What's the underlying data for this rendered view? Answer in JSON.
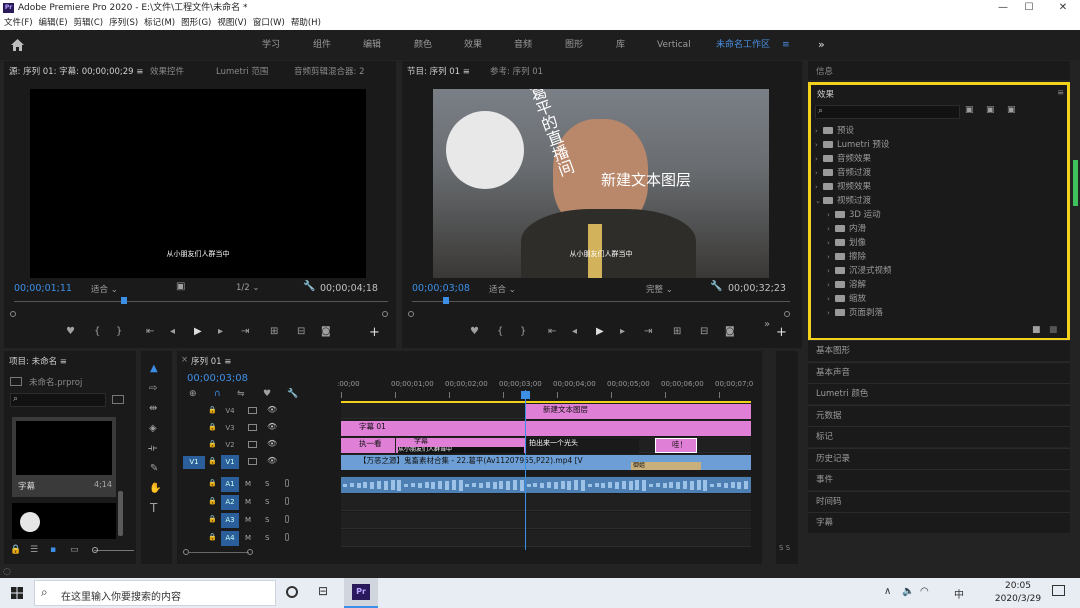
{
  "app": {
    "title": "Adobe Premiere Pro 2020 - E:\\文件\\工程文件\\未命名 *",
    "logo": "Pr"
  },
  "window_controls": {
    "minimize": "—",
    "maximize": "☐",
    "close": "✕"
  },
  "menu": [
    "文件(F)",
    "编辑(E)",
    "剪辑(C)",
    "序列(S)",
    "标记(M)",
    "图形(G)",
    "视图(V)",
    "窗口(W)",
    "帮助(H)"
  ],
  "workspaces": {
    "home_icon": "home-icon",
    "tabs": [
      "学习",
      "组件",
      "编辑",
      "颜色",
      "效果",
      "音频",
      "图形",
      "库",
      "Vertical",
      "未命名工作区"
    ],
    "active": "未命名工作区",
    "menu_glyph": "≡",
    "more": "»"
  },
  "source_monitor": {
    "tabs": [
      "源: 序列 01: 字幕: 00;00;00;29 ≡",
      "效果控件",
      "Lumetri 范围",
      "音频剪辑混合器: 2"
    ],
    "subtitle": "从小朋友们人群当中",
    "timecode": "00;00;01;11",
    "fit": "适合",
    "resolution": "1/2",
    "duration": "00;00;04;18"
  },
  "program_monitor": {
    "tabs": [
      "节目: 序列 01 ≡",
      "参考: 序列 01"
    ],
    "curved_text": "葛平的直播间",
    "text_layer": "新建文本图层",
    "subtitle": "从小朋友们人群当中",
    "timecode": "00;00;03;08",
    "fit": "适合",
    "quality": "完整",
    "duration": "00;00;32;23"
  },
  "info_panel": {
    "title": "信息"
  },
  "effects": {
    "title": "效果",
    "menu_glyph": "≡",
    "search_placeholder": "",
    "items": [
      {
        "label": "预设",
        "indent": 0
      },
      {
        "label": "Lumetri 预设",
        "indent": 0
      },
      {
        "label": "音频效果",
        "indent": 0
      },
      {
        "label": "音频过渡",
        "indent": 0
      },
      {
        "label": "视频效果",
        "indent": 0
      },
      {
        "label": "视频过渡",
        "indent": 0
      },
      {
        "label": "3D 运动",
        "indent": 1
      },
      {
        "label": "内滑",
        "indent": 1
      },
      {
        "label": "划像",
        "indent": 1
      },
      {
        "label": "擦除",
        "indent": 1
      },
      {
        "label": "沉浸式视频",
        "indent": 1
      },
      {
        "label": "溶解",
        "indent": 1
      },
      {
        "label": "缩放",
        "indent": 1
      },
      {
        "label": "页面剥落",
        "indent": 1
      }
    ]
  },
  "right_panels": [
    "基本图形",
    "基本声音",
    "Lumetri 颜色",
    "元数据",
    "标记",
    "历史记录",
    "事件",
    "时间码",
    "字幕"
  ],
  "project": {
    "title": "项目: 未命名 ≡",
    "file": "未命名.prproj",
    "clip_name": "字幕",
    "clip_duration": "4;14"
  },
  "timeline": {
    "title": "序列 01 ≡",
    "timecode": "00;00;03;08",
    "ruler": [
      ":00;00",
      "00;00;01;00",
      "00;00;02;00",
      "00;00;03;00",
      "00;00;04;00",
      "00;00;05;00",
      "00;00;06;00",
      "00;00;07;0"
    ],
    "video_tracks": [
      "V4",
      "V3",
      "V2",
      "V1"
    ],
    "audio_tracks": [
      "A1",
      "A2",
      "A3",
      "A4"
    ],
    "source_patch_v": "V1",
    "mute": "M",
    "solo": "S",
    "clips": {
      "v4": "新建文本图层",
      "v3": "字幕 01",
      "v2a": "执一看",
      "v2b": "字幕",
      "v2b_sub": "从小朋友们人群当中",
      "v2c": "拍出来一个光头",
      "v2d": "哇！",
      "v1": "【万恶之源】鬼畜素材合集 - 22.葛平(Av11207955,P22).mp4 [V",
      "v1_b": "御姐"
    },
    "meter": "S S"
  },
  "taskbar": {
    "search_placeholder": "在这里输入你要搜索的内容",
    "pr_label": "Pr",
    "ime": "中",
    "time": "20:05",
    "date": "2020/3/29"
  },
  "colors": {
    "accent_blue": "#4a90e2",
    "highlight_yellow": "#f2d21b",
    "clip_pink": "#e07fd6",
    "clip_blue": "#6d9fd6"
  }
}
